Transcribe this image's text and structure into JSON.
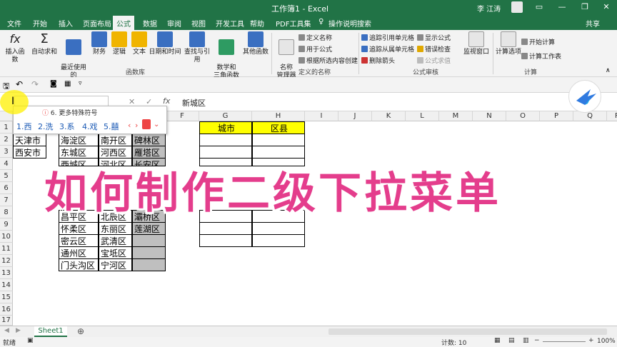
{
  "window": {
    "title": "工作簿1 - Excel",
    "user": "李 江涛",
    "share": "共享"
  },
  "menu": [
    "文件",
    "开始",
    "插入",
    "页面布局",
    "公式",
    "数据",
    "审阅",
    "视图",
    "开发工具",
    "帮助",
    "PDF工具集",
    "操作说明搜索"
  ],
  "ribbon": {
    "lib": [
      "插入函数",
      "自动求和",
      "最近使用的\n函数",
      "财务",
      "逻辑",
      "文本",
      "日期和时间",
      "查找与引用",
      "数学和\n三角函数",
      "其他函数"
    ],
    "lib_group": "函数库",
    "names_big": "名称\n管理器",
    "names_small": [
      "定义名称",
      "用于公式",
      "根据所选内容创建"
    ],
    "names_group": "定义的名称",
    "audit_small": [
      "追踪引用单元格",
      "追踪从属单元格",
      "删除箭头",
      "显示公式",
      "错误检查",
      "公式求值"
    ],
    "audit_group": "公式审核",
    "watch": "监视窗口",
    "calc_big": "计算选项",
    "calc_small": [
      "开始计算",
      "计算工作表"
    ],
    "calc_group": "计算"
  },
  "formula_bar": {
    "fx": "fx",
    "value": "新城区"
  },
  "ime": {
    "tip": "6. 更多特殊符号",
    "candidates": [
      "1.西",
      "2.洗",
      "3.系",
      "4.戏",
      "5.囍"
    ]
  },
  "columns": [
    "",
    "",
    "",
    "",
    "",
    "F",
    "G",
    "H",
    "I",
    "J",
    "K",
    "L",
    "M",
    "N",
    "O",
    "P",
    "Q",
    "R"
  ],
  "rows": [
    "1",
    "2",
    "3",
    "4",
    "5",
    "6",
    "7",
    "8",
    "9",
    "10",
    "11",
    "12",
    "13",
    "14",
    "15",
    "16",
    "17",
    "18"
  ],
  "sheet_cells": {
    "A1": "天津市",
    "A2": "西安市",
    "C1": "海淀区",
    "C2": "东城区",
    "C3": "西城区",
    "C9": "昌平区",
    "C10": "怀柔区",
    "C11": "密云区",
    "C12": "通州区",
    "C13": "门头沟区",
    "D1": "南开区",
    "D2": "河西区",
    "D3": "河北区",
    "D9": "北辰区",
    "D10": "东丽区",
    "D11": "武清区",
    "D12": "宝坻区",
    "D13": "宁河区",
    "E0": "城区",
    "E1": "碑林区",
    "E2": "雁塔区",
    "E3": "长安区",
    "E9": "灞桥区",
    "E10": "莲湖区",
    "G_hdr": "城市",
    "H_hdr": "区县"
  },
  "overlay_title": "如何制作二级下拉菜单",
  "sheet_tab": "Sheet1",
  "status": {
    "ready": "就绪",
    "count": "计数: 10",
    "zoom": "100%"
  }
}
